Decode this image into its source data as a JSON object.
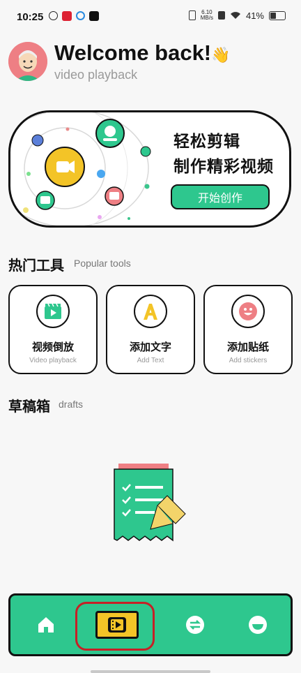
{
  "status_bar": {
    "time": "10:25",
    "network_speed_value": "6.10",
    "network_speed_unit": "MB/s",
    "battery": "41%"
  },
  "header": {
    "welcome": "Welcome back!",
    "wave_emoji": "👋",
    "subtitle": "video playback"
  },
  "banner": {
    "line1": "轻松剪辑",
    "line2": "制作精彩视频",
    "button": "开始创作"
  },
  "popular_tools": {
    "title": "热门工具",
    "subtitle": "Popular tools",
    "items": [
      {
        "title": "视频倒放",
        "subtitle": "Video playback",
        "icon": "clapperboard-play-icon"
      },
      {
        "title": "添加文字",
        "subtitle": "Add Text",
        "icon": "letter-a-icon"
      },
      {
        "title": "添加贴纸",
        "subtitle": "Add stickers",
        "icon": "smiley-icon"
      }
    ]
  },
  "drafts": {
    "title": "草稿箱",
    "subtitle": "drafts"
  },
  "bottom_nav": {
    "items": [
      "home-icon",
      "video-editor-icon",
      "swap-icon",
      "face-icon"
    ]
  },
  "colors": {
    "accent_green": "#2ec78e",
    "accent_yellow": "#f3c427",
    "accent_pink": "#ee7f84",
    "highlight_red": "#c62026"
  }
}
